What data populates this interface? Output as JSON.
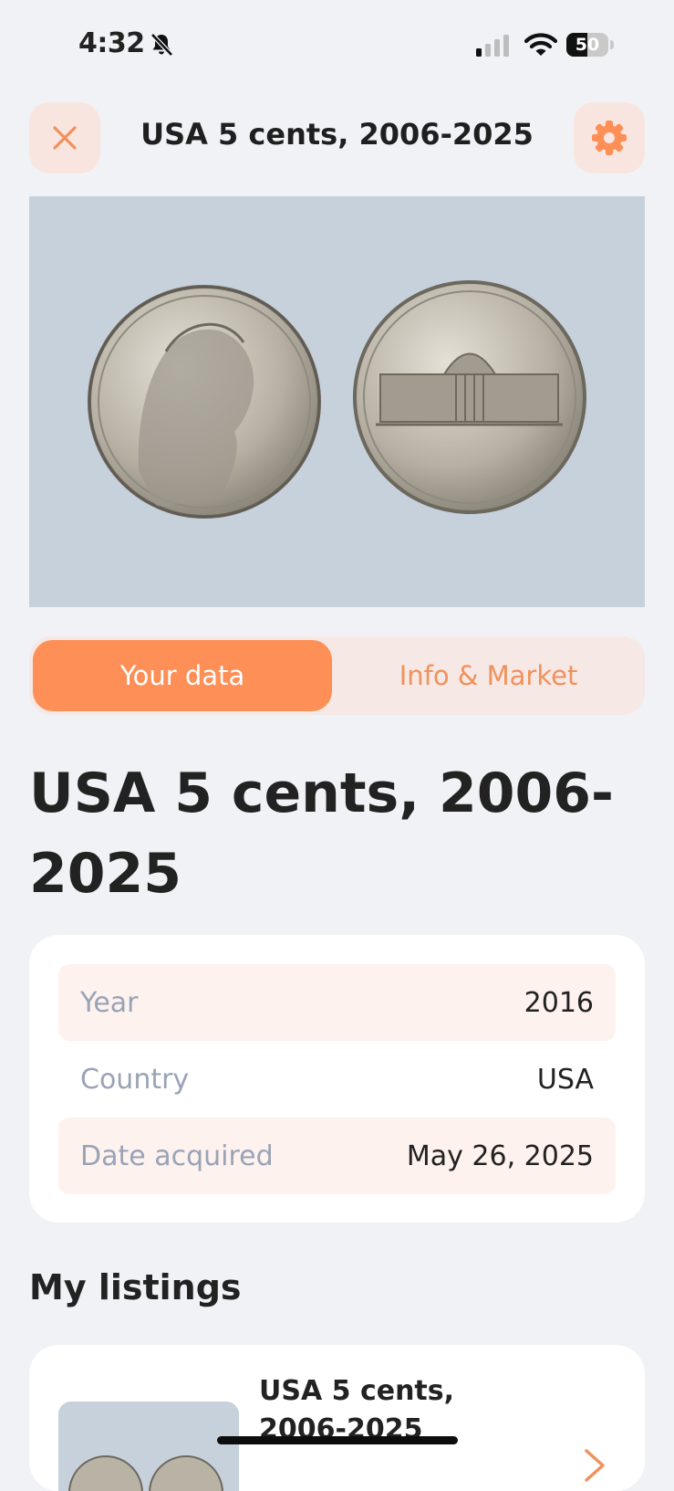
{
  "status_bar": {
    "time": "4:32",
    "battery": "50",
    "battery_level": 0.5
  },
  "header": {
    "title": "USA 5 cents, 2006-2025",
    "close_icon": "close-icon",
    "settings_icon": "gear-icon"
  },
  "tabs": [
    {
      "label": "Your data",
      "active": true
    },
    {
      "label": "Info & Market",
      "active": false
    }
  ],
  "coin": {
    "title": "USA 5 cents, 2006-2025"
  },
  "details": [
    {
      "label": "Year",
      "value": "2016"
    },
    {
      "label": "Country",
      "value": "USA"
    },
    {
      "label": "Date acquired",
      "value": "May 26, 2025"
    }
  ],
  "listings": {
    "section_title": "My listings",
    "items": [
      {
        "title": "USA 5 cents, 2006-2025"
      }
    ]
  },
  "colors": {
    "accent": "#fd8f57",
    "accent_soft": "#f8e5df",
    "background": "#f1f2f6",
    "image_bg": "#c6d1dc"
  }
}
